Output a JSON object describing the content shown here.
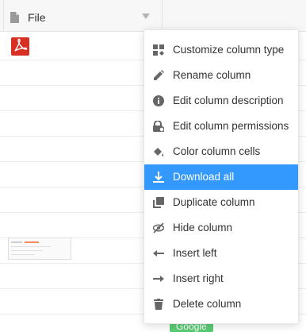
{
  "table": {
    "header": {
      "title": "File",
      "icon": "file-icon",
      "dropdown_icon": "caret-down-icon"
    },
    "cells": {
      "pdf_icon": "pdf-file-icon",
      "thumbnail_icon": "image-thumbnail",
      "badge_label": "Google",
      "badge_color": "#59cb74"
    }
  },
  "menu": {
    "items": [
      {
        "label": "Customize column type",
        "icon": "column-type-icon"
      },
      {
        "label": "Rename column",
        "icon": "pencil-icon"
      },
      {
        "label": "Edit column description",
        "icon": "info-icon"
      },
      {
        "label": "Edit column permissions",
        "icon": "lock-icon"
      },
      {
        "label": "Color column cells",
        "icon": "paint-bucket-icon"
      },
      {
        "label": "Download all",
        "icon": "download-icon",
        "active": true
      },
      {
        "label": "Duplicate column",
        "icon": "duplicate-icon"
      },
      {
        "label": "Hide column",
        "icon": "eye-off-icon"
      },
      {
        "label": "Insert left",
        "icon": "arrow-left-icon"
      },
      {
        "label": "Insert right",
        "icon": "arrow-right-icon"
      },
      {
        "label": "Delete column",
        "icon": "trash-icon"
      }
    ],
    "active_color": "#3399ff"
  }
}
